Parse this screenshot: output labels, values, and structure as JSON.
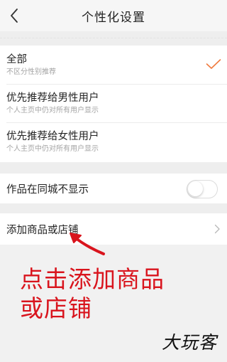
{
  "navbar": {
    "title": "个性化设置",
    "back_icon": "chevron-left-icon"
  },
  "options": [
    {
      "title": "全部",
      "subtitle": "不区分性别推荐",
      "selected": true
    },
    {
      "title": "优先推荐给男性用户",
      "subtitle": "个人主页中仍对所有用户显示",
      "selected": false
    },
    {
      "title": "优先推荐给女性用户",
      "subtitle": "个人主页中仍对所有用户显示",
      "selected": false
    }
  ],
  "toggle_row": {
    "label": "作品在同城不显示",
    "enabled": false
  },
  "add_row": {
    "label": "添加商品或店铺",
    "icon": "chevron-right-icon"
  },
  "annotation": {
    "line1": "点击添加商品",
    "line2": "或店铺"
  },
  "watermark": "大玩客",
  "colors": {
    "accent": "#f07b3f",
    "annotation": "#d9141d",
    "background": "#f1f1f1",
    "card": "#ffffff",
    "subtitle": "#a4a4a4"
  }
}
